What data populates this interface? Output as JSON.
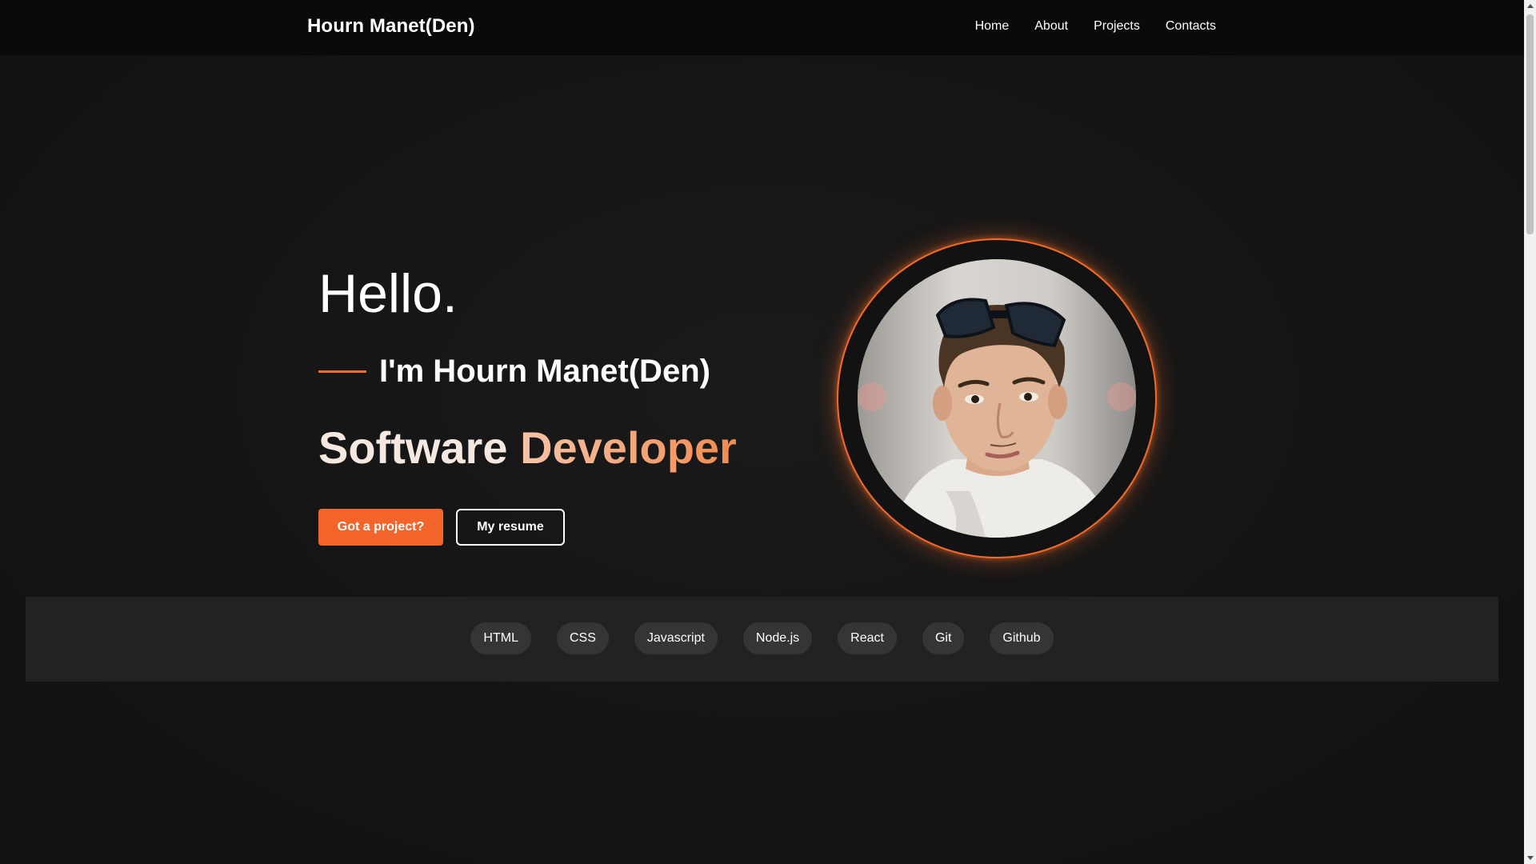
{
  "nav": {
    "brand": "Hourn Manet(Den)",
    "links": [
      "Home",
      "About",
      "Projects",
      "Contacts"
    ]
  },
  "hero": {
    "greeting": "Hello.",
    "intro": "I'm Hourn Manet(Den)",
    "role_first": "Software",
    "role_second": "Developer",
    "primary_button": "Got a project?",
    "secondary_button": "My resume"
  },
  "skills": [
    "HTML",
    "CSS",
    "Javascript",
    "Node.js",
    "React",
    "Git",
    "Github"
  ],
  "colors": {
    "accent": "#f4652c",
    "background": "#141414",
    "navbar": "#0a0a0a",
    "skills_strip": "#222222",
    "skill_pill": "#353535"
  },
  "icons": {
    "avatar": "profile-photo"
  }
}
